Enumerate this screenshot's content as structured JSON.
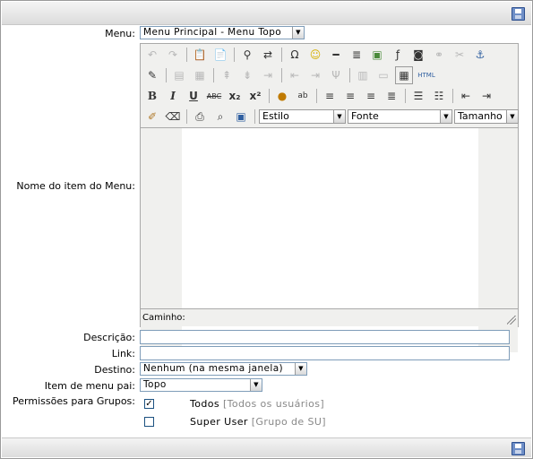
{
  "toolbar_icons": {
    "save": "save-icon"
  },
  "fields": {
    "menu": {
      "label": "Menu:",
      "value": "Menu Principal - Menu Topo"
    },
    "nome": {
      "label": "Nome do item do Menu:"
    },
    "descricao": {
      "label": "Descrição:",
      "value": ""
    },
    "link": {
      "label": "Link:",
      "value": ""
    },
    "destino": {
      "label": "Destino:",
      "value": "Nenhum (na mesma janela)"
    },
    "item_pai": {
      "label": "Item de menu pai:",
      "value": "Topo"
    },
    "permissoes": {
      "label": "Permissões para Grupos:"
    }
  },
  "editor": {
    "style_select": "Estilo",
    "font_select": "Fonte",
    "size_select": "Tamanho",
    "path_label": "Caminho:",
    "html_button": "HTML"
  },
  "groups": [
    {
      "name": "Todos",
      "desc": "[Todos os usuários]",
      "checked": true
    },
    {
      "name": "Super User",
      "desc": "[Grupo de SU]",
      "checked": false
    }
  ]
}
